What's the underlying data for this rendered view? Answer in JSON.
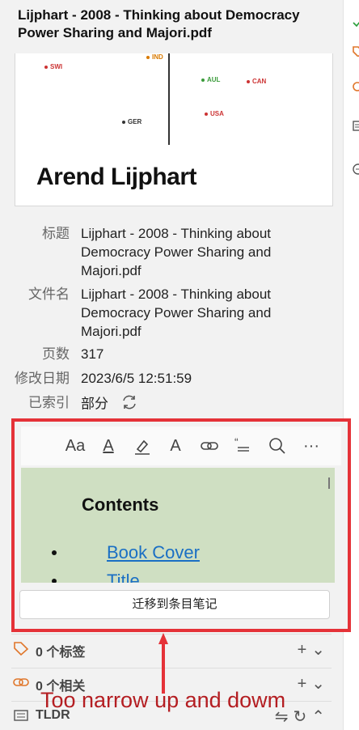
{
  "item": {
    "title": "Lijphart - 2008 - Thinking about Democracy Power Sharing and Majori.pdf"
  },
  "preview": {
    "points": [
      "SWI",
      "IND",
      "AUL",
      "CAN",
      "USA",
      "GER"
    ],
    "author": "Arend Lijphart"
  },
  "meta": {
    "title_label": "标题",
    "title_value": "Lijphart - 2008 - Thinking about Democracy Power Sharing and Majori.pdf",
    "filename_label": "文件名",
    "filename_value": "Lijphart - 2008 - Thinking about Democracy Power Sharing and Majori.pdf",
    "pages_label": "页数",
    "pages_value": "317",
    "modified_label": "修改日期",
    "modified_value": "2023/6/5 12:51:59",
    "indexed_label": "已索引",
    "indexed_value": "部分"
  },
  "note": {
    "heading": "Contents",
    "items": [
      "Book Cover",
      "Title"
    ],
    "migrate_label": "迁移到条目笔记",
    "toolbar": [
      "font-size-icon",
      "text-color-icon",
      "highlight-icon",
      "clear-format-icon",
      "link-icon",
      "cite-icon",
      "search-icon",
      "more-icon"
    ]
  },
  "sections": {
    "tags_label": "0 个标签",
    "related_label": "0 个相关",
    "tldr_label": "TLDR"
  },
  "annotation": {
    "text": "Too narrow up and dowm"
  },
  "colors": {
    "highlight_red": "#e53238",
    "note_bg": "#cfdfc2",
    "link": "#1a6fc4",
    "annotation": "#b41e22"
  }
}
